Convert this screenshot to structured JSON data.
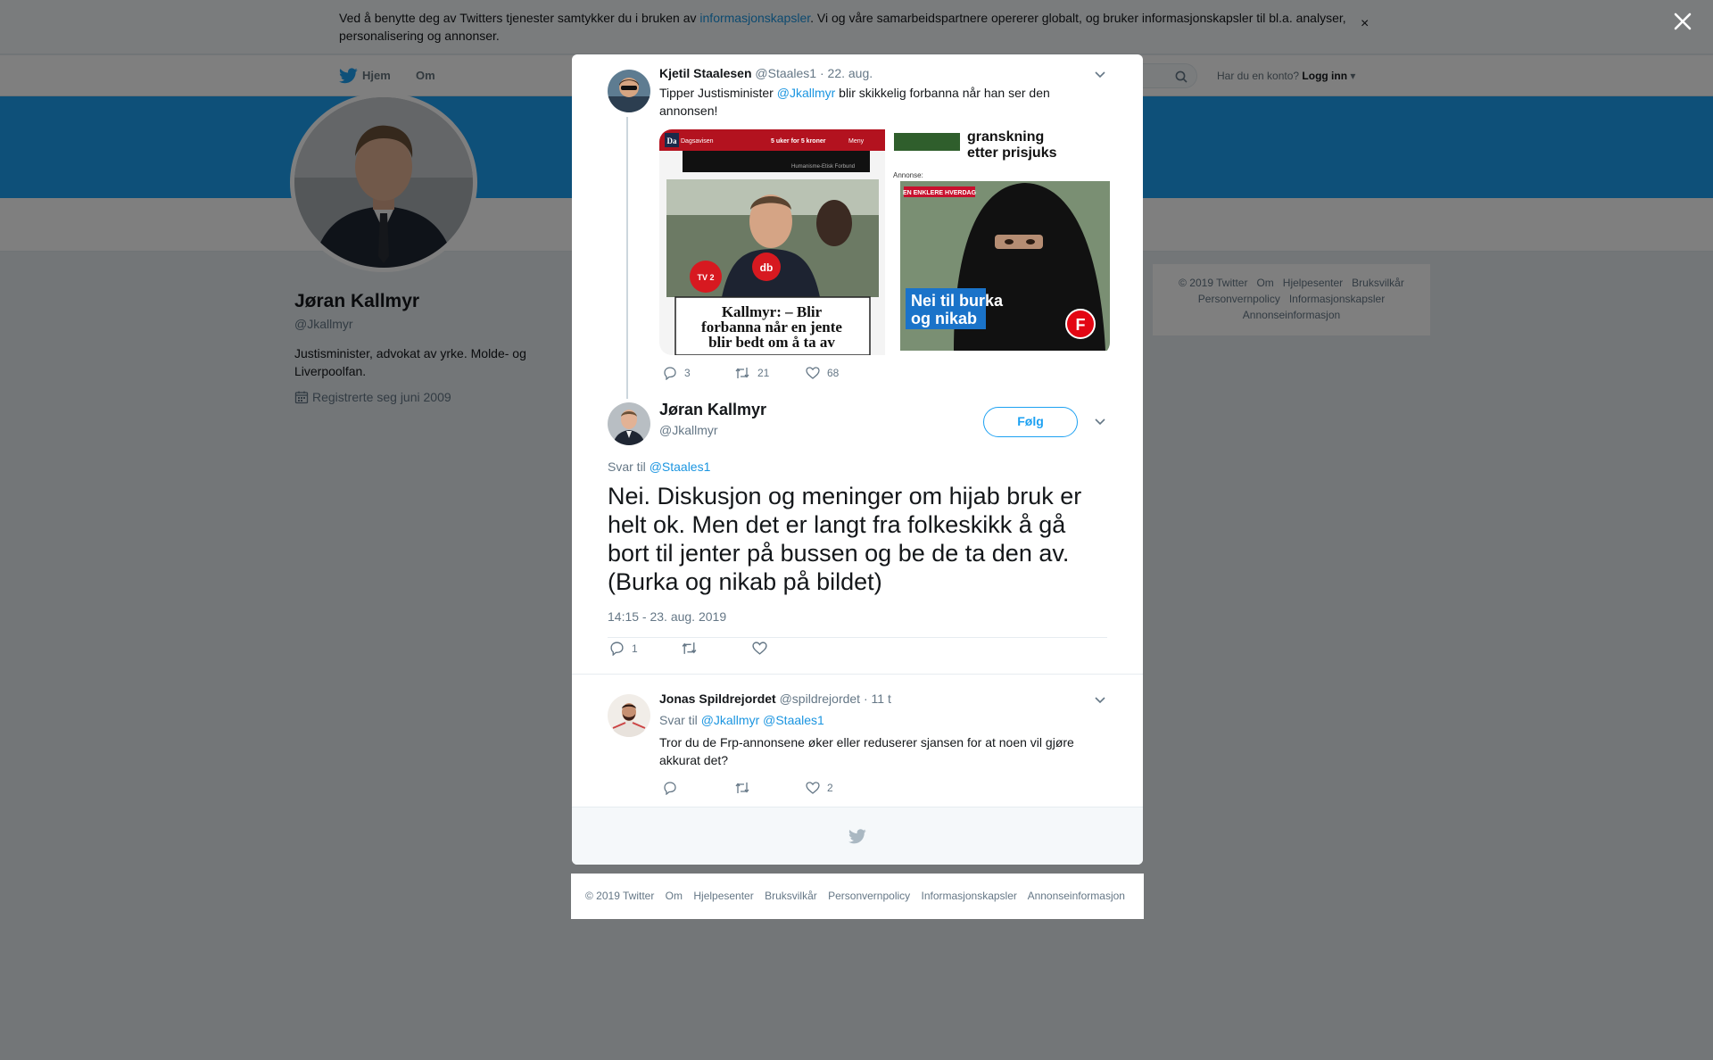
{
  "cookie_banner": {
    "text_before": "Ved å benytte deg av Twitters tjenester samtykker du i bruken av ",
    "link": "informasjonskapsler",
    "text_after": ". Vi og våre samarbeidspartnere opererer globalt, og bruker informasjonskapsler til bl.a. analyser, personalisering og annonser.",
    "close": "×"
  },
  "topnav": {
    "home": "Hjem",
    "about": "Om",
    "account_prompt": "Har du en konto?",
    "login": "Logg inn"
  },
  "profile": {
    "name": "Jøran Kallmyr",
    "handle": "@Jkallmyr",
    "bio": "Justisminister, advokat av yrke. Molde- og Liverpoolfan.",
    "joined": "Registrerte seg juni 2009"
  },
  "side_footer": {
    "row1": [
      "© 2019 Twitter",
      "Om",
      "Hjelpesenter",
      "Bruksvilkår"
    ],
    "row2": [
      "Personvernpolicy",
      "Informasjonskapsler"
    ],
    "row3": [
      "Annonseinformasjon"
    ]
  },
  "parent_tweet": {
    "name": "Kjetil Staalesen",
    "handle": "@Staales1",
    "time": "· 22. aug.",
    "text_before": "Tipper Justisminister ",
    "mention": "@Jkallmyr",
    "text_after": " blir skikkelig forbanna når han ser den annonsen!",
    "replies": "3",
    "retweets": "21",
    "likes": "68",
    "media_left": {
      "brand": "Dagsavisen",
      "promo": "5 uker for 5 kroner",
      "menu": "Meny",
      "caption": "Humanisme-Etisk Forbund",
      "headline": "Kallmyr: – Blir forbanna når en jente blir bedt om å ta av"
    },
    "media_right": {
      "top_headline": "granskning etter prisjuks",
      "ad_label": "Annonse:",
      "ad_tag": "EN ENKLERE HVERDAG",
      "ad_slogan": "Nei til burka og nikab",
      "party_logo": "F"
    }
  },
  "main_tweet": {
    "name": "Jøran Kallmyr",
    "handle": "@Jkallmyr",
    "follow": "Følg",
    "reply_to_label": "Svar til",
    "reply_to": "@Staales1",
    "text": "Nei. Diskusjon og meninger om hijab bruk er helt ok. Men det er langt fra folkeskikk å gå bort til jenter på bussen og be de ta den av. (Burka og nikab på bildet)",
    "timestamp": "14:15 - 23. aug. 2019",
    "replies": "1"
  },
  "reply_tweet": {
    "name": "Jonas Spildrejordet",
    "handle": "@spildrejordet",
    "time": "· 11 t",
    "reply_to_label": "Svar til",
    "reply_to_1": "@Jkallmyr",
    "reply_to_2": "@Staales1",
    "text": "Tror du de Frp-annonsene øker eller reduserer sjansen for at noen vil gjøre akkurat det?",
    "likes": "2"
  },
  "modal_footer": [
    "© 2019 Twitter",
    "Om",
    "Hjelpesenter",
    "Bruksvilkår",
    "Personvernpolicy",
    "Informasjonskapsler",
    "Annonseinformasjon"
  ],
  "colors": {
    "accent": "#1da1f2",
    "link": "#1b95e0",
    "muted": "#657786",
    "overlay": "rgba(0,0,0,0.5)",
    "frp_red": "#e30613"
  },
  "icons": [
    "twitter-bird-icon",
    "search-icon",
    "calendar-icon",
    "close-icon",
    "chevron-down-icon",
    "reply-icon",
    "retweet-icon",
    "like-icon"
  ]
}
